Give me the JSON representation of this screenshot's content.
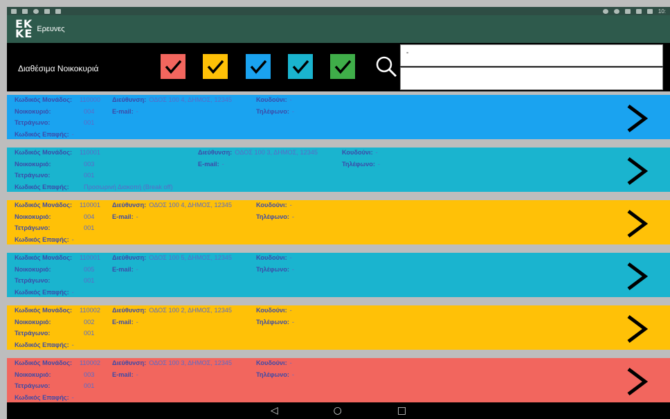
{
  "statusbar": {
    "time": "10:"
  },
  "appbar": {
    "logo_top": "EK",
    "logo_bottom": "KE",
    "title": "Ερευνες"
  },
  "filters": {
    "label": "Διαθέσιμα Νοικοκυριά",
    "checkboxes": [
      {
        "name": "red",
        "color": "#f2665e",
        "checked": true
      },
      {
        "name": "yellow",
        "color": "#ffc107",
        "checked": true
      },
      {
        "name": "blue",
        "color": "#1aa3f0",
        "checked": true
      },
      {
        "name": "cyan",
        "color": "#1ab4cf",
        "checked": true
      },
      {
        "name": "green",
        "color": "#3fae49",
        "checked": true
      }
    ],
    "search_value": "-",
    "icon": "search-icon"
  },
  "labels": {
    "unit_code": "Κωδικός Μονάδος:",
    "address": "Διεύθυνση:",
    "bell": "Κουδούνι:",
    "household": "Νοικοκυριό:",
    "email": "E-mail:",
    "phone": "Τηλέφωνο:",
    "block": "Τετράγωνο:",
    "contact_code": "Κωδικός Επαφής:"
  },
  "households": [
    {
      "color": "#1aa3f0",
      "layout": "a",
      "unit_code": "110000",
      "address": "ΟΔΟΣ 100 4, ΔΗΜΟΣ, 12345",
      "bell": "-",
      "household": "004",
      "email": "-",
      "phone": "-",
      "block": "001",
      "contact_code": "-"
    },
    {
      "color": "#1ab4cf",
      "layout": "b",
      "unit_code": "110001",
      "address": "ΟΔΟΣ 100 3, ΔΗΜΟΣ, 12345",
      "bell": "-",
      "household": "003",
      "email": "-",
      "phone": "-",
      "block": "001",
      "contact_code": "Προσωρινή Διακοπή (Break off)"
    },
    {
      "color": "#ffc107",
      "layout": "a",
      "unit_code": "110001",
      "address": "ΟΔΟΣ 100 4, ΔΗΜΟΣ, 12345",
      "bell": "-",
      "household": "004",
      "email": "-",
      "phone": "-",
      "block": "001",
      "contact_code": "-"
    },
    {
      "color": "#1ab4cf",
      "layout": "a",
      "unit_code": "110001",
      "address": "ΟΔΟΣ 100 5, ΔΗΜΟΣ, 12345",
      "bell": "-",
      "household": "005",
      "email": "-",
      "phone": "-",
      "block": "001",
      "contact_code": "-"
    },
    {
      "color": "#ffc107",
      "layout": "a",
      "unit_code": "110002",
      "address": "ΟΔΟΣ 100 2, ΔΗΜΟΣ, 12345",
      "bell": "-",
      "household": "002",
      "email": "-",
      "phone": "-",
      "block": "001",
      "contact_code": "-"
    },
    {
      "color": "#f2665e",
      "layout": "a",
      "unit_code": "110002",
      "address": "ΟΔΟΣ 100 3, ΔΗΜΟΣ, 12345",
      "bell": "-",
      "household": "003",
      "email": "-",
      "phone": "-",
      "block": "001",
      "contact_code": "-"
    }
  ],
  "navbar": {
    "back": "◁",
    "home": "○",
    "recents": "□"
  }
}
